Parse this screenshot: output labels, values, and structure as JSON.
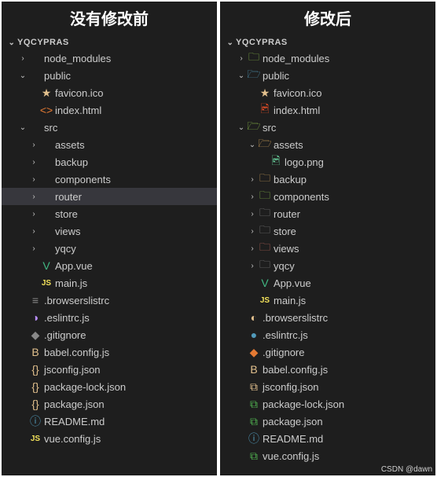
{
  "watermark": "CSDN @dawn",
  "left": {
    "title": "没有修改前",
    "project": "YQCYPRAS",
    "items": [
      {
        "indent": 1,
        "arrow": "right",
        "icon": "",
        "label": "node_modules"
      },
      {
        "indent": 1,
        "arrow": "down",
        "icon": "",
        "label": "public"
      },
      {
        "indent": 2,
        "arrow": "",
        "icon": "★",
        "iconClass": "c-yellow",
        "label": "favicon.ico"
      },
      {
        "indent": 2,
        "arrow": "",
        "icon": "<>",
        "iconClass": "c-orange",
        "label": "index.html"
      },
      {
        "indent": 1,
        "arrow": "down",
        "icon": "",
        "label": "src"
      },
      {
        "indent": 2,
        "arrow": "right",
        "icon": "",
        "label": "assets"
      },
      {
        "indent": 2,
        "arrow": "right",
        "icon": "",
        "label": "backup"
      },
      {
        "indent": 2,
        "arrow": "right",
        "icon": "",
        "label": "components"
      },
      {
        "indent": 2,
        "arrow": "right",
        "icon": "",
        "label": "router",
        "selected": true
      },
      {
        "indent": 2,
        "arrow": "right",
        "icon": "",
        "label": "store"
      },
      {
        "indent": 2,
        "arrow": "right",
        "icon": "",
        "label": "views"
      },
      {
        "indent": 2,
        "arrow": "right",
        "icon": "",
        "label": "yqcy"
      },
      {
        "indent": 2,
        "arrow": "",
        "icon": "V",
        "iconClass": "c-vue",
        "label": "App.vue"
      },
      {
        "indent": 2,
        "arrow": "",
        "icon": "JS",
        "iconClass": "c-js",
        "label": "main.js"
      },
      {
        "indent": 1,
        "arrow": "",
        "icon": "≡",
        "iconClass": "c-gray",
        "label": ".browserslistrc"
      },
      {
        "indent": 1,
        "arrow": "",
        "icon": "◑",
        "iconClass": "c-purple",
        "label": ".eslintrc.js"
      },
      {
        "indent": 1,
        "arrow": "",
        "icon": "◆",
        "iconClass": "c-gray",
        "label": ".gitignore"
      },
      {
        "indent": 1,
        "arrow": "",
        "icon": "B",
        "iconClass": "c-yellow",
        "label": "babel.config.js"
      },
      {
        "indent": 1,
        "arrow": "",
        "icon": "{}",
        "iconClass": "c-yellow",
        "label": "jsconfig.json"
      },
      {
        "indent": 1,
        "arrow": "",
        "icon": "{}",
        "iconClass": "c-yellow",
        "label": "package-lock.json"
      },
      {
        "indent": 1,
        "arrow": "",
        "icon": "{}",
        "iconClass": "c-yellow",
        "label": "package.json"
      },
      {
        "indent": 1,
        "arrow": "",
        "icon": "ⓘ",
        "iconClass": "c-info",
        "label": "README.md"
      },
      {
        "indent": 1,
        "arrow": "",
        "icon": "JS",
        "iconClass": "c-js",
        "label": "vue.config.js"
      }
    ]
  },
  "right": {
    "title": "修改后",
    "project": "YQCYPRAS",
    "items": [
      {
        "indent": 1,
        "arrow": "right",
        "icon": "🗀",
        "iconClass": "c-folder-green",
        "label": "node_modules"
      },
      {
        "indent": 1,
        "arrow": "down",
        "icon": "🗁",
        "iconClass": "c-folder-blue",
        "label": "public"
      },
      {
        "indent": 2,
        "arrow": "",
        "icon": "★",
        "iconClass": "c-yellow",
        "label": "favicon.ico"
      },
      {
        "indent": 2,
        "arrow": "",
        "icon": "🖻",
        "iconClass": "c-red",
        "label": "index.html"
      },
      {
        "indent": 1,
        "arrow": "down",
        "icon": "🗁",
        "iconClass": "c-folder-green",
        "label": "src"
      },
      {
        "indent": 2,
        "arrow": "down",
        "icon": "🗁",
        "iconClass": "c-folder-orange",
        "label": "assets"
      },
      {
        "indent": 3,
        "arrow": "",
        "icon": "🖻",
        "iconClass": "c-folder-teal",
        "label": "logo.png"
      },
      {
        "indent": 2,
        "arrow": "right",
        "icon": "🗀",
        "iconClass": "c-folder-orange",
        "label": "backup"
      },
      {
        "indent": 2,
        "arrow": "right",
        "icon": "🗀",
        "iconClass": "c-folder-green",
        "label": "components"
      },
      {
        "indent": 2,
        "arrow": "right",
        "icon": "🗀",
        "iconClass": "c-folder-gray",
        "label": "router"
      },
      {
        "indent": 2,
        "arrow": "right",
        "icon": "🗀",
        "iconClass": "c-folder-gray",
        "label": "store"
      },
      {
        "indent": 2,
        "arrow": "right",
        "icon": "🗀",
        "iconClass": "c-folder-red",
        "label": "views"
      },
      {
        "indent": 2,
        "arrow": "right",
        "icon": "🗀",
        "iconClass": "c-folder-gray",
        "label": "yqcy"
      },
      {
        "indent": 2,
        "arrow": "",
        "icon": "V",
        "iconClass": "c-vue",
        "label": "App.vue"
      },
      {
        "indent": 2,
        "arrow": "",
        "icon": "JS",
        "iconClass": "c-js",
        "label": "main.js"
      },
      {
        "indent": 1,
        "arrow": "",
        "icon": "◐",
        "iconClass": "c-yellow",
        "label": ".browserslistrc"
      },
      {
        "indent": 1,
        "arrow": "",
        "icon": "●",
        "iconClass": "c-info",
        "label": ".eslintrc.js"
      },
      {
        "indent": 1,
        "arrow": "",
        "icon": "◆",
        "iconClass": "c-orange",
        "label": ".gitignore"
      },
      {
        "indent": 1,
        "arrow": "",
        "icon": "B",
        "iconClass": "c-yellow",
        "label": "babel.config.js"
      },
      {
        "indent": 1,
        "arrow": "",
        "icon": "⧉",
        "iconClass": "c-yellow",
        "label": "jsconfig.json"
      },
      {
        "indent": 1,
        "arrow": "",
        "icon": "⧉",
        "iconClass": "c-greenb",
        "label": "package-lock.json"
      },
      {
        "indent": 1,
        "arrow": "",
        "icon": "⧉",
        "iconClass": "c-greenb",
        "label": "package.json"
      },
      {
        "indent": 1,
        "arrow": "",
        "icon": "ⓘ",
        "iconClass": "c-readme",
        "label": "README.md"
      },
      {
        "indent": 1,
        "arrow": "",
        "icon": "⧉",
        "iconClass": "c-greenb",
        "label": "vue.config.js"
      }
    ]
  }
}
